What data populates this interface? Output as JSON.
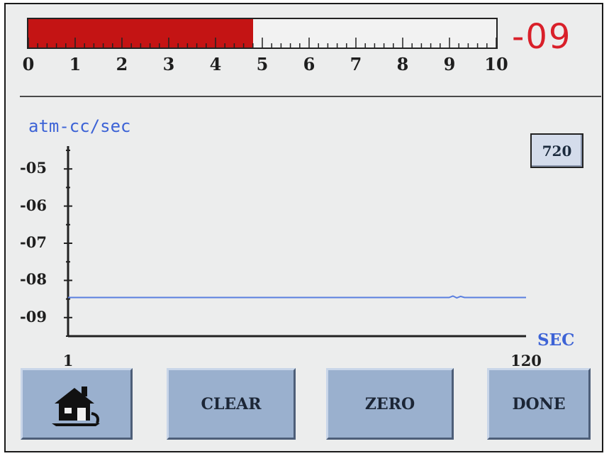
{
  "bar_meter": {
    "fill_fraction": 0.48,
    "scale_labels": [
      "0",
      "1",
      "2",
      "3",
      "4",
      "5",
      "6",
      "7",
      "8",
      "9",
      "10"
    ],
    "fill_color": "#c41414"
  },
  "readout": {
    "value": "-09",
    "color": "#d9202a"
  },
  "chart_data": {
    "type": "line",
    "title": "",
    "ylabel": "atm-cc/sec",
    "xlabel": "SEC",
    "y_tick_labels": [
      "-05",
      "-06",
      "-07",
      "-08",
      "-09"
    ],
    "x_tick_labels": [
      "1",
      "120"
    ],
    "xlim": [
      1,
      120
    ],
    "ylim": [
      -9.5,
      -4.5
    ],
    "series": [
      {
        "x": [
          1,
          20,
          40,
          60,
          80,
          100,
          101,
          102,
          103,
          104,
          110,
          120
        ],
        "y": [
          -8.46,
          -8.46,
          -8.46,
          -8.46,
          -8.46,
          -8.46,
          -8.42,
          -8.47,
          -8.43,
          -8.46,
          -8.46,
          -8.46
        ],
        "color": "#5a7fe0"
      }
    ]
  },
  "time_window": {
    "value": "720"
  },
  "buttons": {
    "home_icon": "home-icon",
    "clear": "CLEAR",
    "zero": "ZERO",
    "done": "DONE"
  }
}
